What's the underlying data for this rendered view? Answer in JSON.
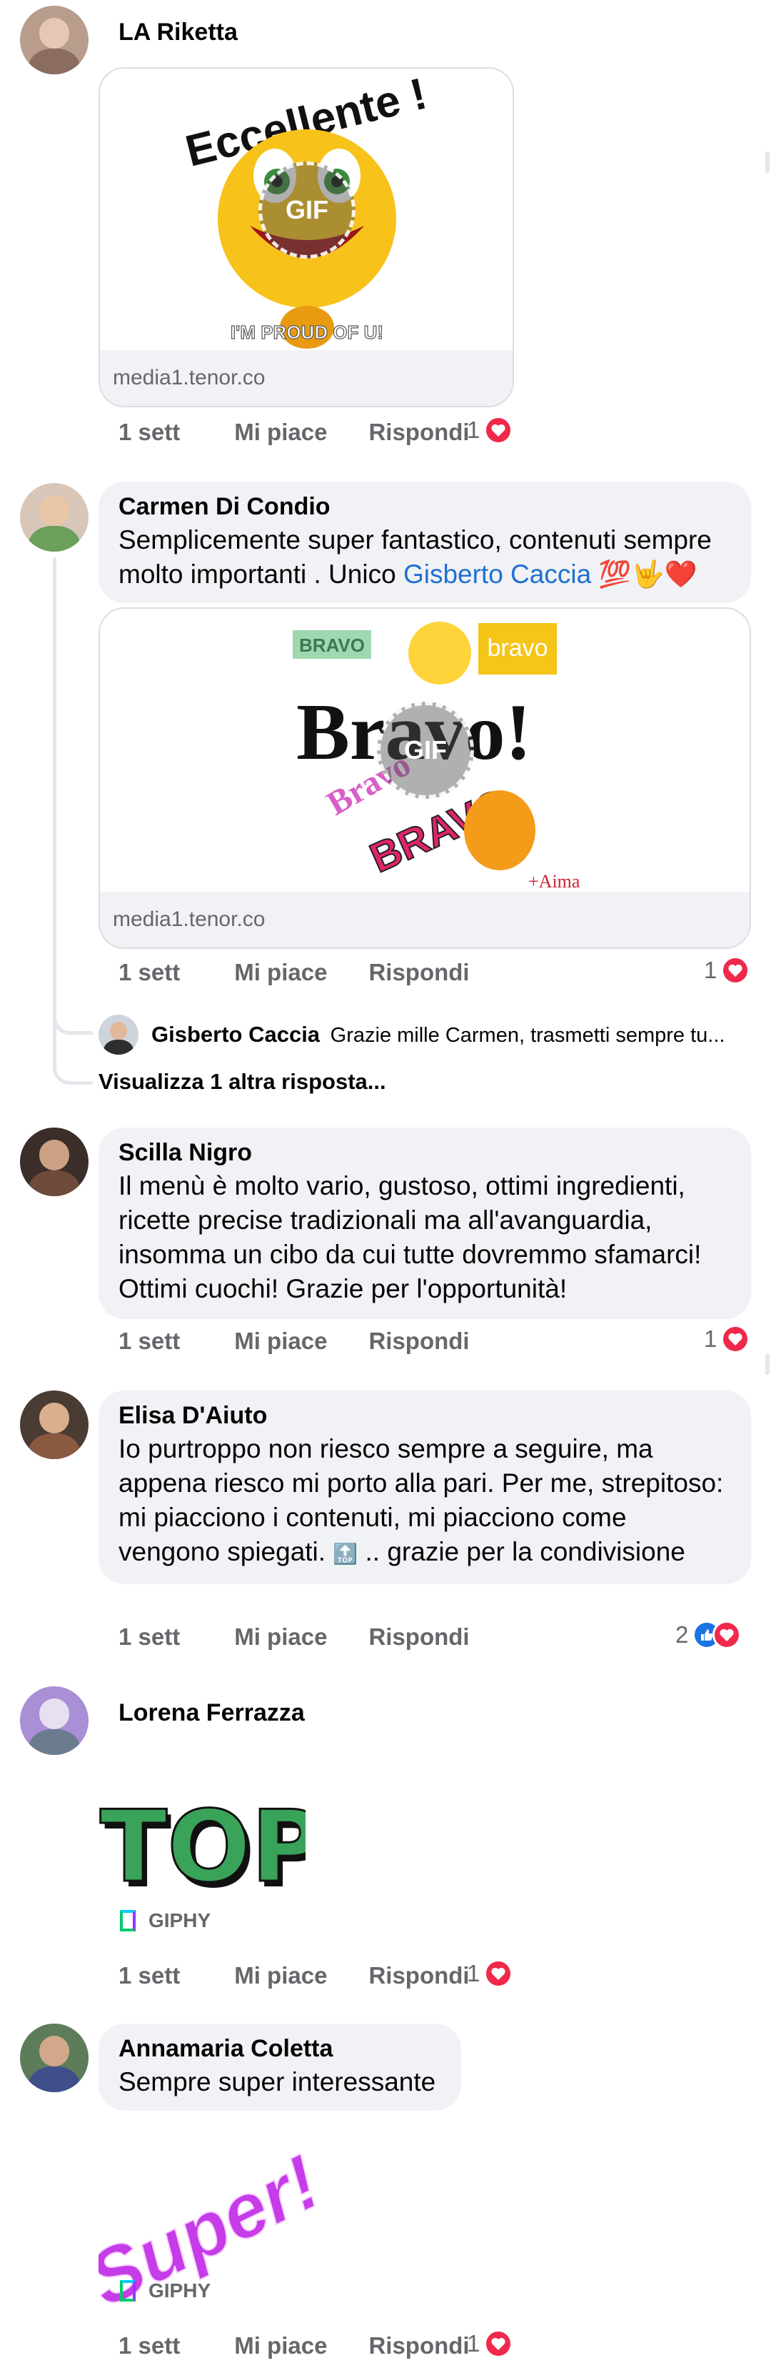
{
  "actions": {
    "time": "1 sett",
    "like": "Mi piace",
    "reply": "Rispondi"
  },
  "comments": [
    {
      "author": "LA Riketta",
      "time": "1 sett",
      "reaction_count": "1",
      "reactions": [
        "love"
      ],
      "gif": {
        "source": "media1.tenor.co",
        "badge": "GIF",
        "caption_top": "Eccellente !",
        "caption_bottom": "I'M PROUD OF U!"
      }
    },
    {
      "author": "Carmen Di Condio",
      "text_before": "Semplicemente super fantastico, contenuti sempre molto importanti . Unico ",
      "mention": "Gisberto Caccia",
      "text_after": " 💯🤟❤️",
      "time": "1 sett",
      "reaction_count": "1",
      "reactions": [
        "love"
      ],
      "gif": {
        "source": "media1.tenor.co",
        "badge": "GIF",
        "main_word": "Bravo!",
        "tag1": "BRAVO",
        "tag2": "bravo",
        "tag3": "Bravo",
        "tag4": "BRAVO",
        "sign": "+Aima"
      },
      "reply": {
        "author": "Gisberto Caccia",
        "text": "Grazie mille Carmen, trasmetti sempre tu..."
      },
      "more_replies": "Visualizza 1 altra risposta..."
    },
    {
      "author": "Scilla Nigro",
      "text": "Il menù è molto vario, gustoso, ottimi ingredienti, ricette precise tradizionali ma all'avanguardia, insomma un cibo da cui tutte dovremmo sfamarci! Ottimi cuochi! Grazie per l'opportunità!",
      "time": "1 sett",
      "reaction_count": "1",
      "reactions": [
        "love"
      ]
    },
    {
      "author": "Elisa D'Aiuto",
      "text_before": "Io purtroppo non riesco sempre a seguire, ma appena riesco mi porto alla pari. Per me, strepitoso: mi piacciono i contenuti, mi piacciono come vengono spiegati. ",
      "emoji": "🔝",
      "text_after": " .. grazie per la condivisione",
      "time": "1 sett",
      "reaction_count": "2",
      "reactions": [
        "like",
        "love"
      ]
    },
    {
      "author": "Lorena Ferrazza",
      "sticker_text": "TOP",
      "giphy": "GIPHY",
      "time": "1 sett",
      "reaction_count": "1",
      "reactions": [
        "love"
      ]
    },
    {
      "author": "Annamaria Coletta",
      "text": "Sempre super interessante",
      "sticker_text": "Super!",
      "giphy": "GIPHY",
      "time": "1 sett",
      "reaction_count": "1",
      "reactions": [
        "love"
      ]
    }
  ],
  "colors": {
    "mention": "#1f6fd1",
    "love": "#f0284a",
    "like": "#1b74e4",
    "bubble": "#f0f2f5",
    "meta": "#65676b"
  }
}
